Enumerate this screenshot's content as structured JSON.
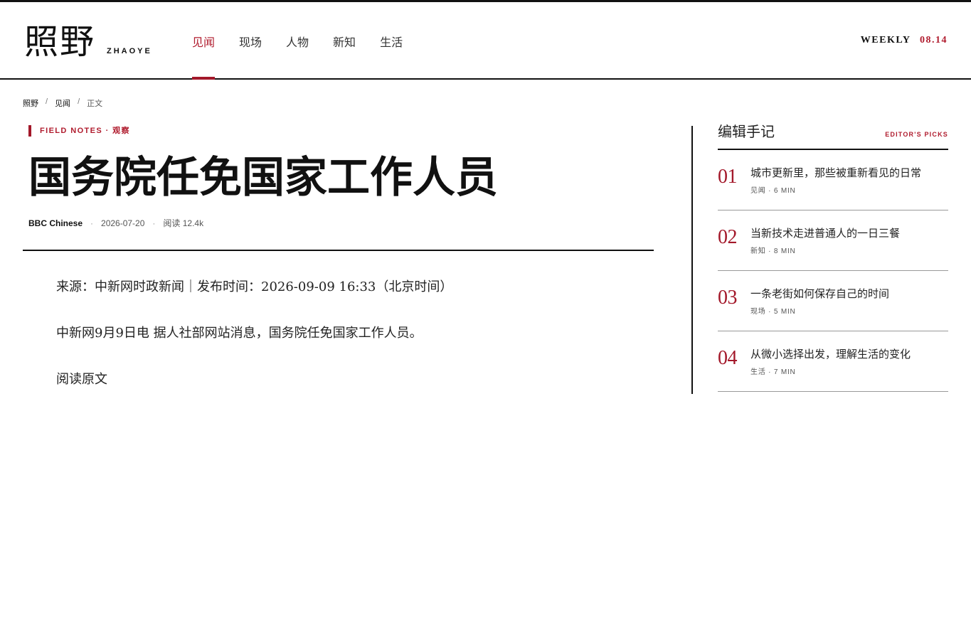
{
  "header": {
    "logo_cn": "照野",
    "logo_en": "ZHAOYE",
    "nav": [
      {
        "label": "见闻",
        "active": true
      },
      {
        "label": "现场"
      },
      {
        "label": "人物"
      },
      {
        "label": "新知"
      },
      {
        "label": "生活"
      }
    ],
    "issue_label": "WEEKLY",
    "issue_date": "08.14"
  },
  "breadcrumb": {
    "items": [
      "照野",
      "见闻",
      "正文"
    ],
    "separator": "/"
  },
  "article": {
    "kicker": "FIELD NOTES · 观察",
    "headline": "国务院任免国家工作人员",
    "author": "BBC Chinese",
    "date": "2026-07-20",
    "reads": "阅读 12.4k",
    "meta_separator": "·",
    "paragraphs": [
      "来源：中新网时政新闻｜发布时间：2026-09-09 16:33（北京时间）",
      "中新网9月9日电 据人社部网站消息，国务院任免国家工作人员。"
    ],
    "read_original": "阅读原文"
  },
  "sidebar": {
    "title": "编辑手记",
    "subtitle": "EDITOR'S PICKS",
    "items": [
      {
        "num": "01",
        "title": "城市更新里，那些被重新看见的日常",
        "meta": "见闻 · 6 MIN"
      },
      {
        "num": "02",
        "title": "当新技术走进普通人的一日三餐",
        "meta": "新知 · 8 MIN"
      },
      {
        "num": "03",
        "title": "一条老街如何保存自己的时间",
        "meta": "现场 · 5 MIN"
      },
      {
        "num": "04",
        "title": "从微小选择出发，理解生活的变化",
        "meta": "生活 · 7 MIN"
      }
    ]
  },
  "colors": {
    "accent": "#a3182a",
    "text": "#111111"
  }
}
